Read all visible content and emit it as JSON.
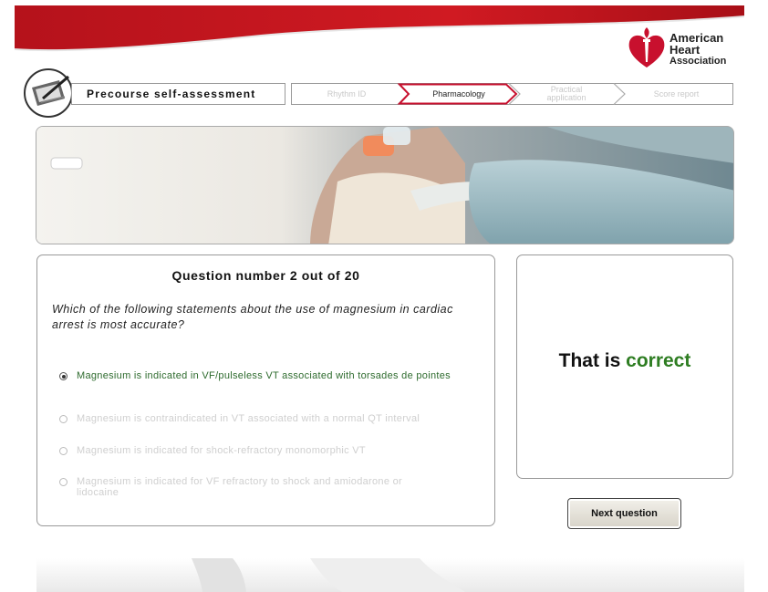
{
  "brand": {
    "line1": "American",
    "line2": "Heart",
    "line3": "Association"
  },
  "header": {
    "title": "Precourse self-assessment",
    "steps": [
      {
        "line1": "Rhythm ID",
        "line2": "",
        "active": false
      },
      {
        "line1": "Pharmacology",
        "line2": "",
        "active": true
      },
      {
        "line1": "Practical",
        "line2": "application",
        "active": false
      },
      {
        "line1": "Score report",
        "line2": "",
        "active": false
      }
    ]
  },
  "question": {
    "number_text": "Question number 2 out of 20",
    "text": "Which of the following statements about the use of magnesium in cardiac arrest is most accurate?",
    "options": [
      {
        "label": "Magnesium is indicated in VF/pulseless VT associated with torsades de pointes",
        "selected": true
      },
      {
        "label": "Magnesium is contraindicated in VT associated with a normal QT interval",
        "selected": false
      },
      {
        "label": "Magnesium is indicated for shock-refractory monomorphic VT",
        "selected": false
      },
      {
        "label": "Magnesium is indicated for VF refractory to shock and amiodarone or lidocaine",
        "selected": false
      }
    ]
  },
  "feedback": {
    "prefix": "That is",
    "word": "correct"
  },
  "buttons": {
    "next": "Next question"
  },
  "colors": {
    "brand_red": "#c8102e",
    "correct_green": "#2e7d22"
  }
}
